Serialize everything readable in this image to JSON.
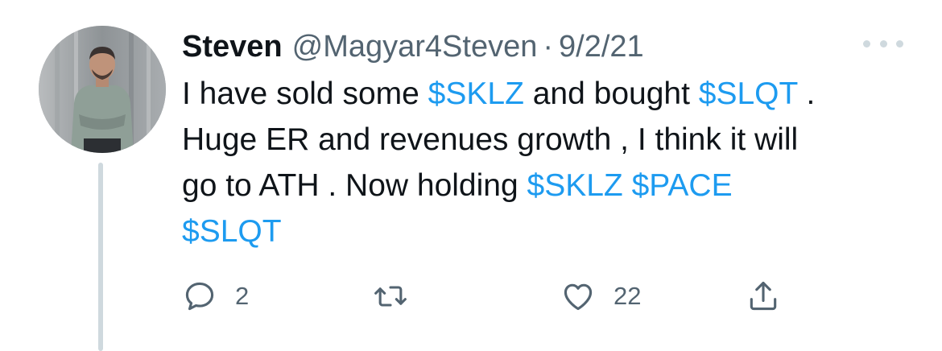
{
  "tweet": {
    "author_name": "Steven",
    "author_handle": "@Magyar4Steven",
    "separator": "·",
    "date": "9/2/21",
    "more_icon": "more-horizontal-icon",
    "body_lines": [
      [
        "I have sold some ",
        "$SKLZ",
        " and bought ",
        "$SLQT",
        " ."
      ],
      [
        "Huge ER and revenues growth , I think it will"
      ],
      [
        "go to ATH . Now holding ",
        "$SKLZ",
        " ",
        "$PACE"
      ],
      [
        "$SLQT"
      ]
    ],
    "cashtag_color": "#1d9bf0"
  },
  "actions": {
    "reply": {
      "icon": "reply-icon",
      "count": "2"
    },
    "retweet": {
      "icon": "retweet-icon",
      "count": ""
    },
    "like": {
      "icon": "heart-icon",
      "count": "22"
    },
    "share": {
      "icon": "share-icon"
    }
  }
}
